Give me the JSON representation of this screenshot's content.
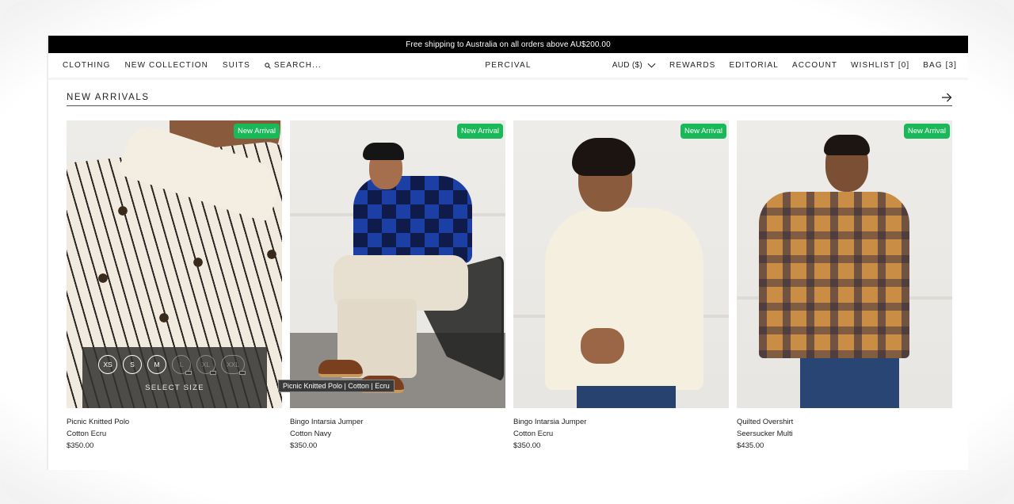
{
  "promo_bar": {
    "text": "Free shipping to Australia on all orders above AU$200.00"
  },
  "nav": {
    "left": [
      {
        "label": "CLOTHING"
      },
      {
        "label": "NEW COLLECTION"
      },
      {
        "label": "SUITS"
      }
    ],
    "search": {
      "label": "SEARCH...",
      "icon": "search-icon"
    },
    "brand": "PERCIVAL",
    "currency": {
      "label": "AUD ($)",
      "icon": "chevron-down-icon"
    },
    "right": [
      {
        "label": "REWARDS"
      },
      {
        "label": "EDITORIAL"
      },
      {
        "label": "ACCOUNT"
      },
      {
        "label": "WISHLIST [0]"
      },
      {
        "label": "BAG [3]"
      }
    ]
  },
  "section": {
    "title": "NEW ARRIVALS",
    "arrow_icon": "arrow-right-icon"
  },
  "colors": {
    "promo_bg": "#000000",
    "badge_green": "#19b95a",
    "text": "#1a1a1a"
  },
  "products": [
    {
      "badge": "New Arrival",
      "name": "Picnic Knitted Polo",
      "variant": "Cotton Ecru",
      "price": "$350.00",
      "size_picker": {
        "label": "SELECT SIZE",
        "sizes": [
          {
            "label": "XS",
            "available": true
          },
          {
            "label": "S",
            "available": true
          },
          {
            "label": "M",
            "available": true
          },
          {
            "label": "L",
            "available": false
          },
          {
            "label": "XL",
            "available": false
          },
          {
            "label": "XXL",
            "available": false
          }
        ]
      },
      "tooltip": "Picnic Knitted Polo | Cotton | Ecru"
    },
    {
      "badge": "New Arrival",
      "name": "Bingo Intarsia Jumper",
      "variant": "Cotton Navy",
      "price": "$350.00"
    },
    {
      "badge": "New Arrival",
      "name": "Bingo Intarsia Jumper",
      "variant": "Cotton Ecru",
      "price": "$350.00"
    },
    {
      "badge": "New Arrival",
      "name": "Quilted Overshirt",
      "variant": "Seersucker Multi",
      "price": "$435.00"
    }
  ]
}
